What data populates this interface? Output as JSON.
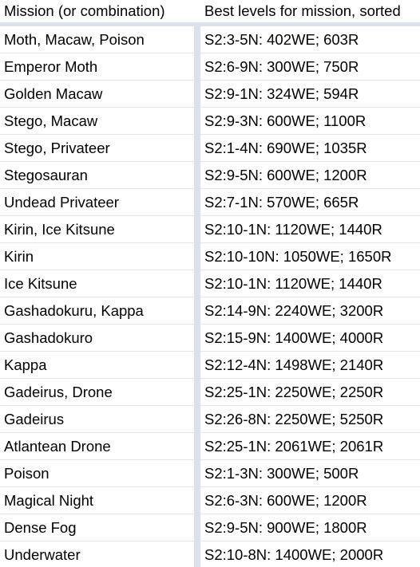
{
  "table": {
    "columns": [
      {
        "id": "mission",
        "label": "Mission (or combination)"
      },
      {
        "id": "levels",
        "label": "Best levels for mission, sorted"
      }
    ],
    "rows": [
      {
        "mission": "Moth, Macaw, Poison",
        "levels": "S2:3-5N: 402WE; 603R"
      },
      {
        "mission": "Emperor Moth",
        "levels": "S2:6-9N: 300WE; 750R"
      },
      {
        "mission": "Golden Macaw",
        "levels": "S2:9-1N: 324WE; 594R"
      },
      {
        "mission": "Stego, Macaw",
        "levels": "S2:9-3N: 600WE; 1100R"
      },
      {
        "mission": "Stego, Privateer",
        "levels": "S2:1-4N: 690WE; 1035R"
      },
      {
        "mission": "Stegosauran",
        "levels": "S2:9-5N: 600WE; 1200R"
      },
      {
        "mission": "Undead Privateer",
        "levels": "S2:7-1N: 570WE; 665R"
      },
      {
        "mission": "Kirin, Ice Kitsune",
        "levels": "S2:10-1N: 1120WE; 1440R"
      },
      {
        "mission": "Kirin",
        "levels": "S2:10-10N: 1050WE; 1650R"
      },
      {
        "mission": "Ice Kitsune",
        "levels": "S2:10-1N: 1120WE; 1440R"
      },
      {
        "mission": "Gashadokuru, Kappa",
        "levels": "S2:14-9N: 2240WE; 3200R"
      },
      {
        "mission": "Gashadokuro",
        "levels": "S2:15-9N: 1400WE; 4000R"
      },
      {
        "mission": "Kappa",
        "levels": "S2:12-4N: 1498WE; 2140R"
      },
      {
        "mission": "Gadeirus, Drone",
        "levels": "S2:25-1N: 2250WE; 2250R"
      },
      {
        "mission": "Gadeirus",
        "levels": "S2:26-8N: 2250WE; 5250R"
      },
      {
        "mission": "Atlantean Drone",
        "levels": "S2:25-1N: 2061WE; 2061R"
      },
      {
        "mission": "Poison",
        "levels": "S2:1-3N: 300WE; 500R"
      },
      {
        "mission": "Magical Night",
        "levels": "S2:6-3N: 600WE; 1200R"
      },
      {
        "mission": "Dense Fog",
        "levels": "S2:9-5N: 900WE; 1800R"
      },
      {
        "mission": "Underwater",
        "levels": "S2:10-8N: 1400WE; 2000R"
      }
    ]
  },
  "colors": {
    "page_background": "#ffffff",
    "cell_background": "#ffffff",
    "row_separator": "#e6e6e6",
    "column_gap": "#dde1ea",
    "header_underline": "#dde1ea",
    "text": "#000000"
  }
}
